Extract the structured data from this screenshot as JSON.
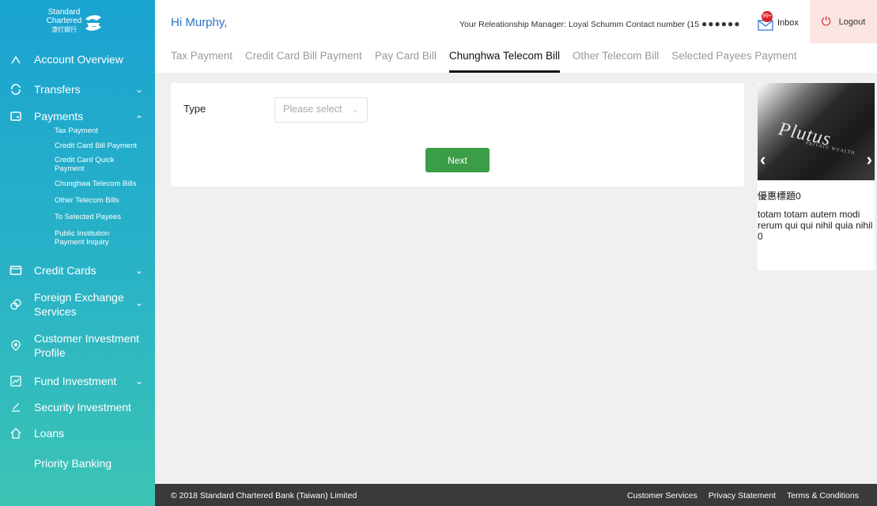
{
  "logo": {
    "line1": "Standard",
    "line2": "Chartered",
    "line3": "渣打銀行"
  },
  "sidebar": {
    "items": [
      {
        "label": "Account Overview",
        "icon": "account-icon"
      },
      {
        "label": "Transfers",
        "icon": "transfer-icon",
        "chevron": "⌄"
      },
      {
        "label": "Payments",
        "icon": "payments-icon",
        "chevron": "⌃"
      },
      {
        "label": "Credit Cards",
        "icon": "credit-card-icon",
        "chevron": "⌄"
      },
      {
        "label": "Foreign Exchange Services",
        "icon": "foreign-exchange-icon",
        "chevron": "⌄"
      },
      {
        "label": "Customer Investment Profile",
        "icon": "investment-profile-icon"
      },
      {
        "label": "Fund Investment",
        "icon": "fund-icon",
        "chevron": "⌄"
      },
      {
        "label": "Security Investment",
        "icon": "security-icon"
      },
      {
        "label": "Loans",
        "icon": "loans-icon"
      },
      {
        "label": "Priority Banking"
      }
    ],
    "payments_sub": [
      "Tax Payment",
      "Credit Card Bill Payment",
      "Credit Card Quick Payment",
      "Chunghwa Telecom Bills",
      "Other Telecom Bills",
      "To Selected Payees",
      "Public Institution Payment Inquiry"
    ]
  },
  "header": {
    "greeting": "Hi Murphy,",
    "rm_text": "Your Releationship Manager: Loyal Schumm Contact number (15",
    "rm_mask": "●●●●●●",
    "inbox_label": "Inbox",
    "inbox_badge": "99+",
    "logout_label": "Logout"
  },
  "tabs": [
    {
      "label": "Tax Payment"
    },
    {
      "label": "Credit Card Bill Payment"
    },
    {
      "label": "Pay Card Bill"
    },
    {
      "label": "Chunghwa Telecom Bill",
      "active": true
    },
    {
      "label": "Other Telecom Bill"
    },
    {
      "label": "Selected Payees Payment"
    }
  ],
  "form": {
    "type_label": "Type",
    "type_placeholder": "Please select",
    "next_label": "Next"
  },
  "promo": {
    "brand": "Plutus",
    "brand_sub": "PRIVATE WEALTH",
    "title": "優惠標題0",
    "body": "totam totam autem modi rerum qui qui nihil quia nihil 0"
  },
  "footer": {
    "copyright": "© 2018 Standard Chartered Bank (Taiwan) Limited",
    "links": [
      "Customer Services",
      "Privacy Statement",
      "Terms & Conditions"
    ]
  },
  "colors": {
    "accent": "#2a6fc9",
    "sidebar_top": "#1aa3d1",
    "sidebar_bottom": "#3cc4b4",
    "button": "#3c9d48",
    "logout_bg": "#fbe5e3",
    "footer_bg": "#3a3a3a"
  }
}
